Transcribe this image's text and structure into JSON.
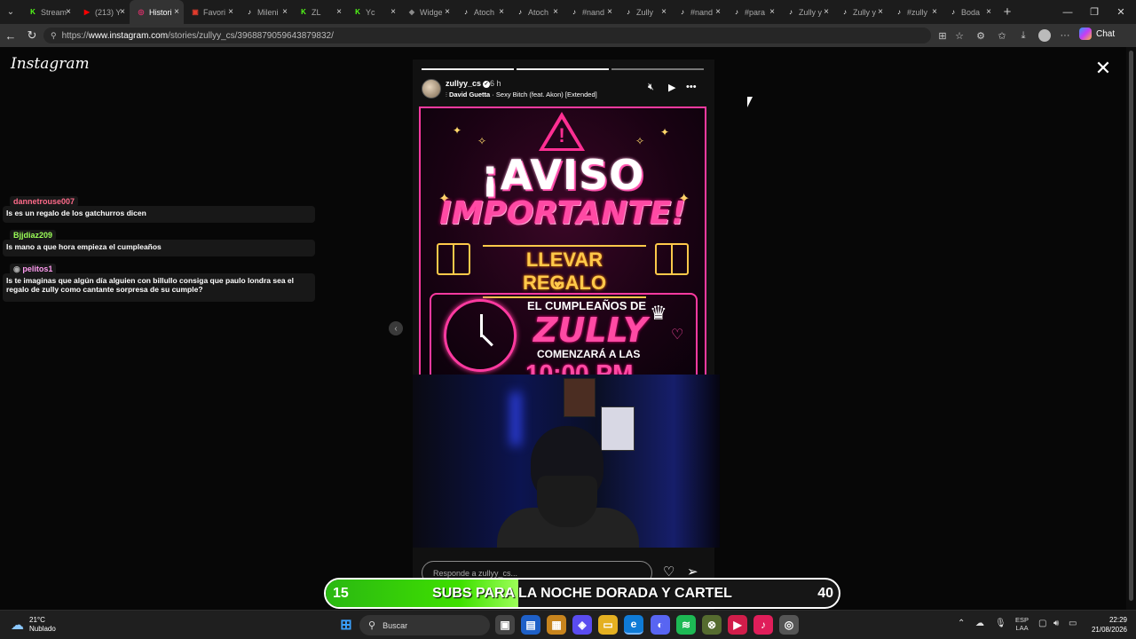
{
  "browser": {
    "tabs": [
      {
        "title": "Stream",
        "icon": "kick-icon",
        "color": "#53fc18"
      },
      {
        "title": "(213) Y",
        "icon": "youtube-icon",
        "color": "#ff0000"
      },
      {
        "title": "Histori",
        "icon": "instagram-icon",
        "color": "#e1306c",
        "active": true
      },
      {
        "title": "Favori",
        "icon": "ticket-icon",
        "color": "#e23b2c"
      },
      {
        "title": "Mileni",
        "icon": "tiktok-icon",
        "color": "#ffffff"
      },
      {
        "title": "ZL",
        "icon": "kick-icon",
        "color": "#53fc18"
      },
      {
        "title": "Yc",
        "icon": "kick-icon",
        "color": "#53fc18"
      },
      {
        "title": "Widge",
        "icon": "widget-icon",
        "color": "#8a8a8a"
      },
      {
        "title": "Atoch",
        "icon": "tiktok-icon",
        "color": "#ffffff"
      },
      {
        "title": "Atoch",
        "icon": "tiktok-icon",
        "color": "#ffffff"
      },
      {
        "title": "#nand",
        "icon": "tiktok-icon",
        "color": "#ffffff"
      },
      {
        "title": "Zully",
        "icon": "tiktok-icon",
        "color": "#ffffff"
      },
      {
        "title": "#nand",
        "icon": "tiktok-icon",
        "color": "#ffffff"
      },
      {
        "title": "#para",
        "icon": "tiktok-icon",
        "color": "#ffffff"
      },
      {
        "title": "Zully y",
        "icon": "tiktok-icon",
        "color": "#ffffff"
      },
      {
        "title": "Zully y",
        "icon": "tiktok-icon",
        "color": "#ffffff"
      },
      {
        "title": "#zully",
        "icon": "tiktok-icon",
        "color": "#ffffff"
      },
      {
        "title": "Boda",
        "icon": "tiktok-icon",
        "color": "#ffffff"
      }
    ],
    "url_prefix": "https://",
    "url_host": "www.instagram.com",
    "url_path": "/stories/zullyy_cs/3968879059643879832/",
    "copilot_label": "Chat"
  },
  "page": {
    "logo": "Instagram",
    "chat": [
      {
        "user": "dannetrouse007",
        "user_color": "#ff6b8a",
        "message": "Is es un regalo de los gatchurros dicen"
      },
      {
        "user": "Bjjdiaz209",
        "user_color": "#9cff58",
        "message": "Is mano a que hora empieza el cumpleaños"
      },
      {
        "user": "pelitos1",
        "user_color": "#ff9bf0",
        "message": "Is te imaginas que algún día alguien con billullo consiga que paulo londra sea el regalo de zully como cantante sorpresa de su cumple?"
      }
    ],
    "story": {
      "username": "zullyy_cs",
      "time": "6 h",
      "song_artist": "David Guetta",
      "song_title": "Sexy Bitch (feat. Akon) [Extended]",
      "reply_placeholder": "Responde a zullyy_cs...",
      "poster": {
        "headline": "¡AVISO",
        "headline2": "IMPORTANTE!",
        "gift_text": "LLEVAR REGALO",
        "event_label": "EL CUMPLEAÑOS DE",
        "name": "ZULLY",
        "starts": "COMENZARÁ A LAS",
        "time": "10:00 PM"
      }
    }
  },
  "banner": {
    "current": "15",
    "text": "SUBS PARA LA NOCHE DORADA Y CARTEL",
    "goal": "40",
    "progress_fraction": 0.375
  },
  "taskbar": {
    "temp": "21°C",
    "weather": "Nublado",
    "search_label": "Buscar",
    "lang1": "ESP",
    "lang2": "LAA",
    "time": "22:29",
    "date": "21/08/2026"
  }
}
